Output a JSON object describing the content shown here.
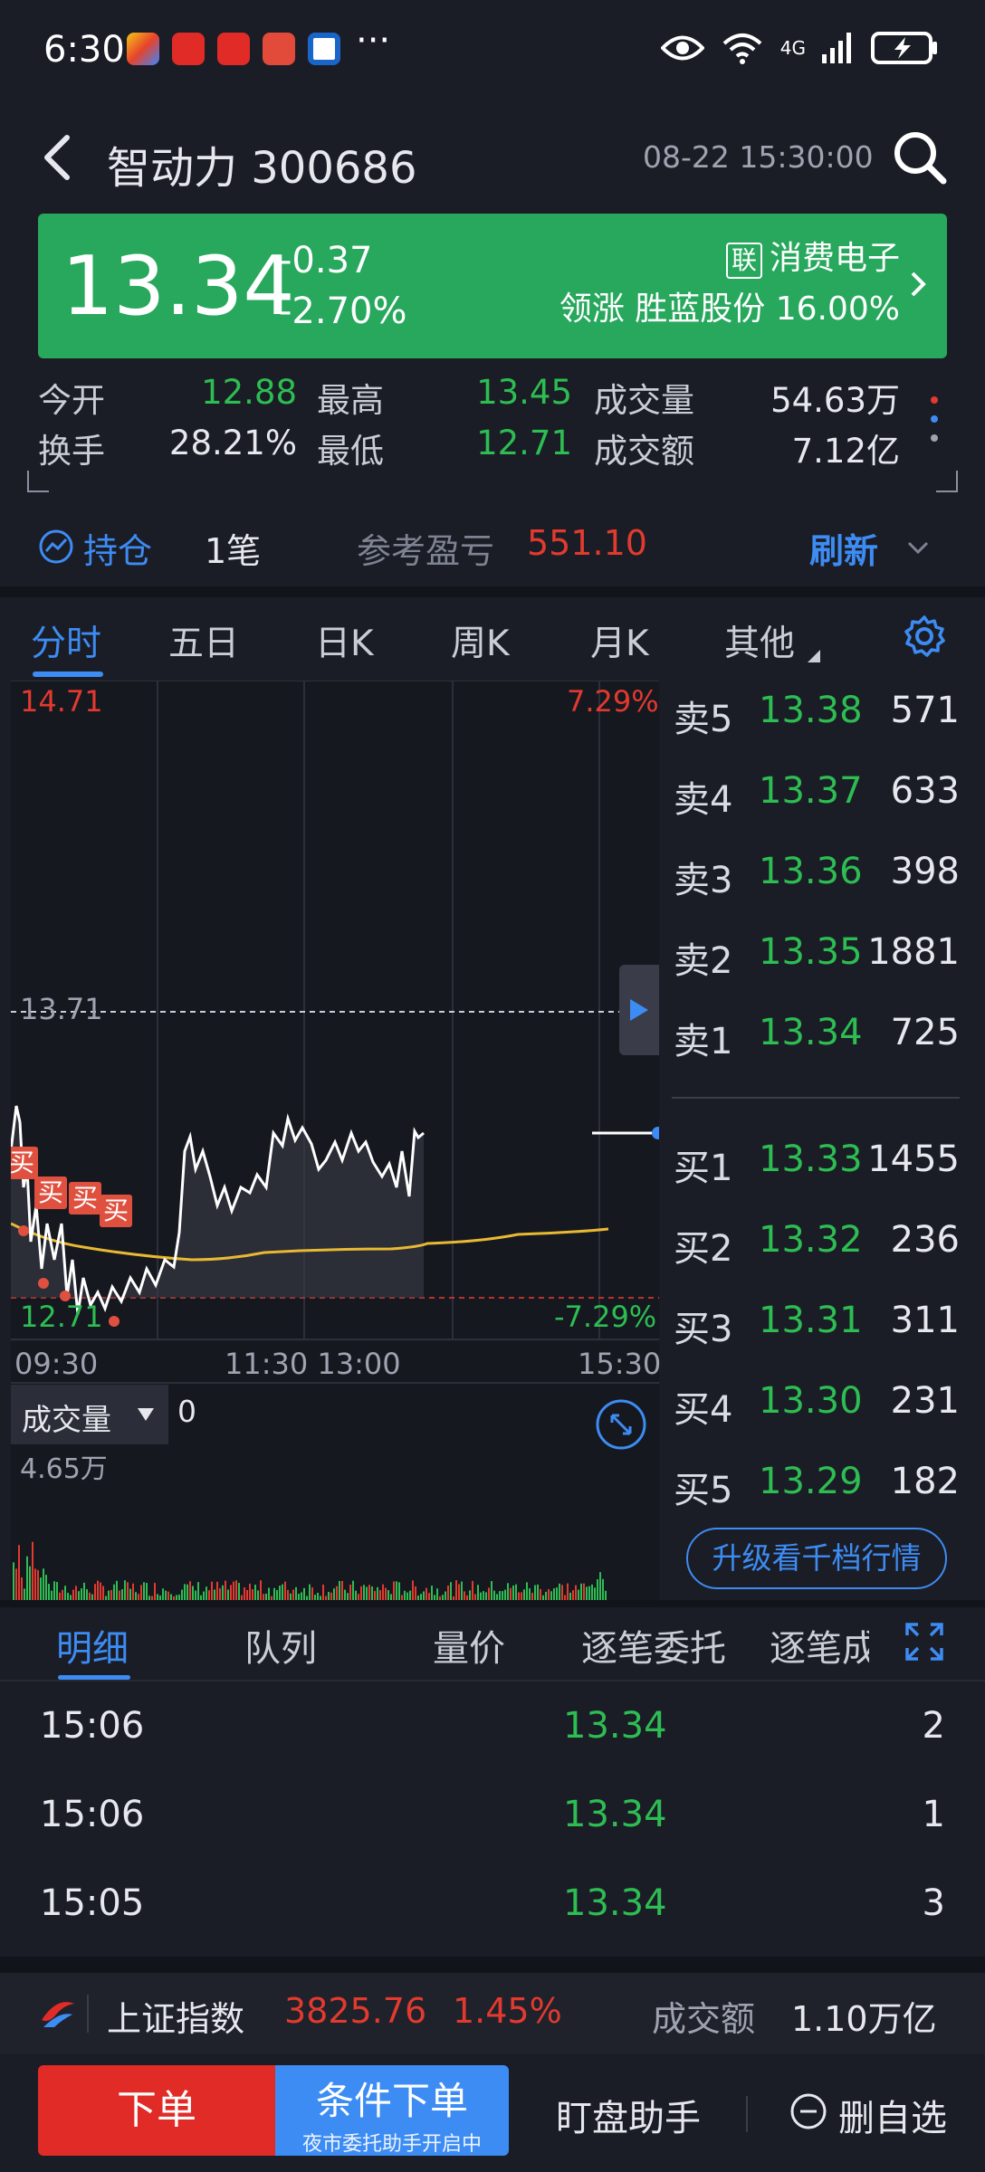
{
  "status": {
    "time": "6:30",
    "dots": "···",
    "network": "4G"
  },
  "header": {
    "title": "智动力 300686",
    "datetime": "08-22 15:30:00"
  },
  "banner": {
    "price": "13.34",
    "change": "-0.37",
    "change_pct": "-2.70%",
    "sector_tag": "联",
    "sector": "消费电子",
    "leader": "领涨 胜蓝股份 16.00%"
  },
  "stats": {
    "open_label": "今开",
    "open": "12.88",
    "high_label": "最高",
    "high": "13.45",
    "vol_label": "成交量",
    "vol": "54.63万",
    "turnover_label": "换手",
    "turnover": "28.21%",
    "low_label": "最低",
    "low": "12.71",
    "amount_label": "成交额",
    "amount": "7.12亿"
  },
  "holding": {
    "label": "持仓",
    "count": "1笔",
    "pl_label": "参考盈亏",
    "pl": "551.10",
    "refresh": "刷新"
  },
  "tabs": [
    "分时",
    "五日",
    "日K",
    "周K",
    "月K",
    "其他"
  ],
  "chart": {
    "top_price": "14.71",
    "top_pct": "7.29%",
    "mid_price": "13.71",
    "bottom_price": "12.71",
    "bottom_pct": "-7.29%",
    "x_labels": [
      "09:30",
      "11:30 13:00",
      "15:30"
    ],
    "buy_marker": "买",
    "volume_label": "成交量",
    "volume_value": "0",
    "volume_max": "4.65万"
  },
  "orderbook": {
    "asks": [
      {
        "label": "卖5",
        "price": "13.38",
        "vol": "571"
      },
      {
        "label": "卖4",
        "price": "13.37",
        "vol": "633"
      },
      {
        "label": "卖3",
        "price": "13.36",
        "vol": "398"
      },
      {
        "label": "卖2",
        "price": "13.35",
        "vol": "1881"
      },
      {
        "label": "卖1",
        "price": "13.34",
        "vol": "725"
      }
    ],
    "bids": [
      {
        "label": "买1",
        "price": "13.33",
        "vol": "1455"
      },
      {
        "label": "买2",
        "price": "13.32",
        "vol": "236"
      },
      {
        "label": "买3",
        "price": "13.31",
        "vol": "311"
      },
      {
        "label": "买4",
        "price": "13.30",
        "vol": "231"
      },
      {
        "label": "买5",
        "price": "13.29",
        "vol": "182"
      }
    ],
    "upgrade": "升级看千档行情"
  },
  "detail_tabs": [
    "明细",
    "队列",
    "量价",
    "逐笔委托",
    "逐笔成"
  ],
  "trades": [
    {
      "time": "15:06",
      "price": "13.34",
      "vol": "2"
    },
    {
      "time": "15:06",
      "price": "13.34",
      "vol": "1"
    },
    {
      "time": "15:05",
      "price": "13.34",
      "vol": "3"
    }
  ],
  "index": {
    "name": "上证指数",
    "value": "3825.76",
    "pct": "1.45%",
    "amount_label": "成交额",
    "amount": "1.10万亿"
  },
  "actions": {
    "order": "下单",
    "cond": "条件下单",
    "cond_sub": "夜市委托助手开启中",
    "assistant": "盯盘助手",
    "remove": "删自选"
  },
  "colors": {
    "up": "#e23a2e",
    "down": "#2dbd52",
    "accent": "#3d8cf3",
    "banner": "#27a85d"
  }
}
